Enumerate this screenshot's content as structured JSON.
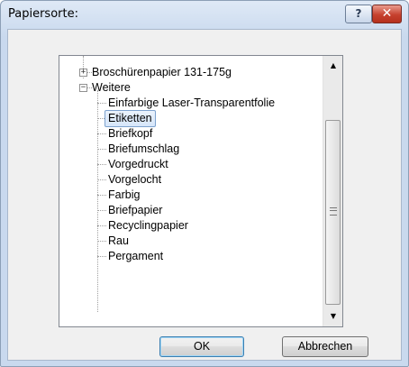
{
  "window": {
    "title": "Papiersorte:",
    "help_label": "?",
    "close_label": "✕"
  },
  "tree": {
    "parent_node": "Broschürenpapier 131-175g",
    "group_node": "Weitere",
    "items": [
      "Einfarbige Laser-Transparentfolie",
      "Etiketten",
      "Briefkopf",
      "Briefumschlag",
      "Vorgedruckt",
      "Vorgelocht",
      "Farbig",
      "Briefpapier",
      "Recyclingpapier",
      "Rau",
      "Pergament"
    ],
    "selected_item": "Etiketten"
  },
  "scrollbar": {
    "up_icon": "scroll-up-arrow",
    "down_icon": "scroll-down-arrow"
  },
  "buttons": {
    "ok": "OK",
    "cancel": "Abbrechen"
  }
}
